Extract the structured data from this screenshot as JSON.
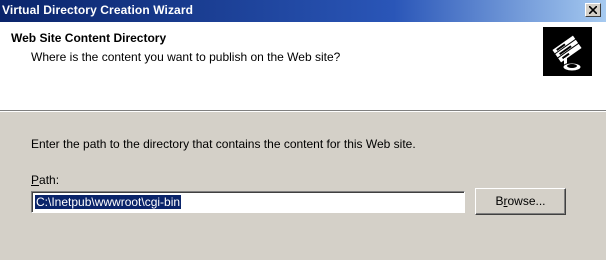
{
  "window": {
    "title": "Virtual Directory Creation Wizard",
    "close_label": "×"
  },
  "header": {
    "title": "Web Site Content Directory",
    "subtitle": "Where is the content you want to publish on the Web site?",
    "icon": "wizard-book-icon"
  },
  "body": {
    "instruction": "Enter the path to the directory that contains the content for this Web site.",
    "path_label_accel": "P",
    "path_label_rest": "ath:",
    "path_value": "C:\\Inetpub\\wwwroot\\cgi-bin",
    "browse_label_pre": "B",
    "browse_label_accel": "r",
    "browse_label_post": "owse..."
  },
  "colors": {
    "titlebar_start": "#0a246a",
    "titlebar_end": "#a6caf0",
    "dialog_bg": "#d4d0c8",
    "selection_bg": "#0a246a"
  }
}
